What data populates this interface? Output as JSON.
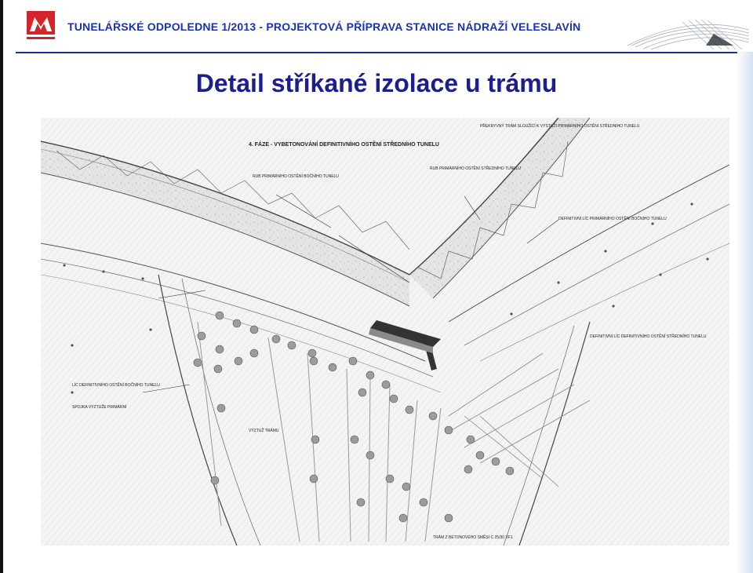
{
  "header": {
    "text": "TUNELÁŘSKÉ ODPOLEDNE 1/2013  - PROJEKTOVÁ PŘÍPRAVA STANICE NÁDRAŽÍ VELESLAVÍN",
    "logo_icon": "company-logo",
    "accent_color": "#1a33a8",
    "logo_color": "#d4262a"
  },
  "slide": {
    "title": "Detail stříkané izolace u trámu"
  },
  "drawing": {
    "icon": "technical-drawing",
    "labels": {
      "phase": "4. FÁZE - VYBETONOVÁNÍ DEFINITIVNÍHO OSTĚNÍ STŘEDNÍHO TUNELU",
      "primary_lining_side": "RUB PRIMÁRNÍHO OSTĚNÍ BOČNÍHO TUNELU",
      "primary_lining_mid": "RUB PRIMÁRNÍHO OSTĚNÍ STŘEDNÍHO TUNELU",
      "mid_tunnel_top": "PŘEKRYVNÝ TRÁM SLOUŽÍCÍ K VÝSTUŽI PRIMÁRNÍHO OSTĚNÍ STŘEDNÍHO TUNELU",
      "primary_side_def": "DEFINITIVNÍ LÍC PRIMÁRNÍHO OSTĚNÍ BOČNÍHO TUNELU",
      "secondary_mid": "DEFINITIVNÍ LÍC DEFINITIVNÍHO OSTĚNÍ STŘEDNÍHO TUNELU",
      "stirrups": "VÝZTUŽ TRÁMU",
      "drain": "SPOJKA VÝZTUŽE PRIMÁRNÍ",
      "bottom_note": "TRÁM Z BETONOVÉHO SMĚSI C 25/30 XF1",
      "side_note": "LÍC DEFINITIVNÍHO OSTĚNÍ BOČNÍHO TUNELU"
    }
  }
}
